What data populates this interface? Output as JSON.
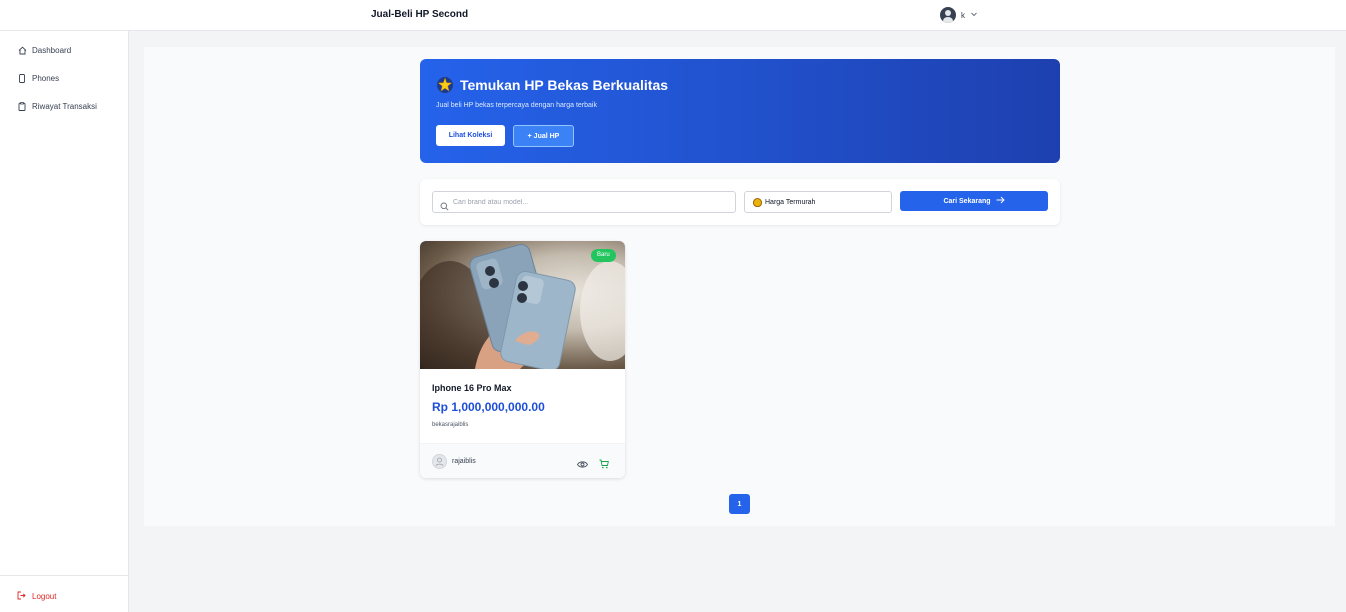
{
  "header": {
    "brand": "Jual-Beli HP Second",
    "user": {
      "name": "k",
      "avatar_icon": "user-avatar-icon",
      "menu_icon": "chevron-down-icon"
    }
  },
  "sidebar": {
    "items": [
      {
        "label": "Dashboard",
        "icon": "home-icon"
      },
      {
        "label": "Phones",
        "icon": "smartphone-icon"
      },
      {
        "label": "Riwayat Transaksi",
        "icon": "clipboard-icon"
      }
    ],
    "logout": {
      "label": "Logout",
      "icon": "logout-icon"
    }
  },
  "hero": {
    "title": "Temukan HP Bekas Berkualitas",
    "title_icon": "sparkle-icon",
    "subtitle": "Jual beli HP bekas terpercaya dengan harga terbaik",
    "primary_button": "Lihat Koleksi",
    "secondary_button": "+ Jual HP"
  },
  "search": {
    "placeholder": "Cari brand atau model...",
    "value": "",
    "sort_selected": "Harga Termurah",
    "sort_icon": "money-bag-icon",
    "submit_label": "Cari Sekarang"
  },
  "products": [
    {
      "name": "Iphone 16 Pro Max",
      "price": "Rp 1,000,000,000.00",
      "description": "bekasrajaiblis",
      "badge": "Baru",
      "seller": "rajaiblis"
    }
  ],
  "pagination": {
    "current": "1"
  },
  "colors": {
    "primary": "#2563eb",
    "hero_gradient_end": "#1e40af",
    "badge_green": "#22c55e",
    "logout_red": "#dc2626",
    "cart_green": "#16a34a"
  }
}
